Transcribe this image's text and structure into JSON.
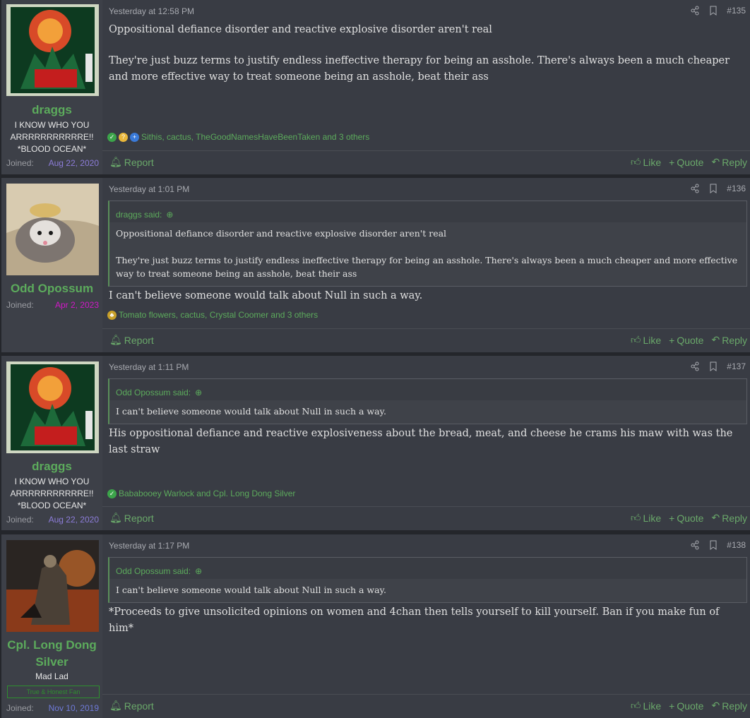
{
  "posts": [
    {
      "username": "draggs",
      "user_title_lines": [
        "I KNOW WHO YOU",
        "ARRRRRRRRRRRE!!",
        "*BLOOD OCEAN*"
      ],
      "joined_label": "Joined:",
      "joined_date": "Aug 22, 2020",
      "joined_color": "#8c7cd8",
      "timestamp": "Yesterday at 12:58 PM",
      "post_number": "#135",
      "paragraphs": [
        "Oppositional defiance disorder and reactive explosive disorder aren't real",
        "They're just buzz terms to justify endless ineffective therapy for being an asshole. There's always been a much cheaper and more effective way to treat someone being an asshole, beat their ass"
      ],
      "reactions_text": "Sithis, cactus, TheGoodNamesHaveBeenTaken and 3 others",
      "report_label": "Report",
      "like_label": "Like",
      "quote_label": "Quote",
      "reply_label": "Reply"
    },
    {
      "username": "Odd Opossum",
      "joined_label": "Joined:",
      "joined_date": "Apr 2, 2023",
      "joined_color": "#d218c8",
      "timestamp": "Yesterday at 1:01 PM",
      "post_number": "#136",
      "quote_author": "draggs said:",
      "quote_paragraphs": [
        "Oppositional defiance disorder and reactive explosive disorder aren't real",
        "They're just buzz terms to justify endless ineffective therapy for being an asshole. There's always been a much cheaper and more effective way to treat someone being an asshole, beat their ass"
      ],
      "paragraphs": [
        "I can't believe someone would talk about Null in such a way."
      ],
      "reactions_text": "Tomato flowers, cactus, Crystal Coomer and 3 others",
      "report_label": "Report",
      "like_label": "Like",
      "quote_label": "Quote",
      "reply_label": "Reply"
    },
    {
      "username": "draggs",
      "user_title_lines": [
        "I KNOW WHO YOU",
        "ARRRRRRRRRRRE!!",
        "*BLOOD OCEAN*"
      ],
      "joined_label": "Joined:",
      "joined_date": "Aug 22, 2020",
      "joined_color": "#8c7cd8",
      "timestamp": "Yesterday at 1:11 PM",
      "post_number": "#137",
      "quote_author": "Odd Opossum said:",
      "quote_paragraphs": [
        "I can't believe someone would talk about Null in such a way."
      ],
      "paragraphs": [
        "His oppositional defiance and reactive explosiveness about the bread, meat, and cheese he crams his maw with was the last straw"
      ],
      "reactions_text": "Bababooey Warlock and Cpl. Long Dong Silver",
      "report_label": "Report",
      "like_label": "Like",
      "quote_label": "Quote",
      "reply_label": "Reply"
    },
    {
      "username_lines": [
        "Cpl. Long Dong",
        "Silver"
      ],
      "user_title_lines": [
        "Mad Lad"
      ],
      "banner_text": "True & Honest Fan",
      "joined_label": "Joined:",
      "joined_date": "Nov 10, 2019",
      "joined_color": "#6f7ad8",
      "timestamp": "Yesterday at 1:17 PM",
      "post_number": "#138",
      "quote_author": "Odd Opossum said:",
      "quote_paragraphs": [
        "I can't believe someone would talk about Null in such a way."
      ],
      "paragraphs": [
        "*Proceeds to give unsolicited opinions on women and 4chan then tells yourself to kill yourself. Ban if you make fun of him*"
      ],
      "report_label": "Report",
      "like_label": "Like",
      "quote_label": "Quote",
      "reply_label": "Reply"
    }
  ],
  "colors": {
    "accent_green": "#5cab5c",
    "post_bg": "#393c44",
    "user_bg": "#3d4048",
    "page_bg": "#24262b"
  }
}
